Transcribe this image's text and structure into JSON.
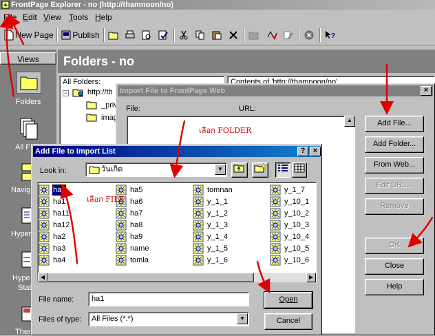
{
  "app": {
    "title": "FrontPage Explorer - no (http://thamnoon/no)",
    "menu": [
      "File",
      "Edit",
      "View",
      "Tools",
      "Help"
    ],
    "toolbar": {
      "new_page": "New Page",
      "publish": "Publish"
    }
  },
  "views": {
    "header": "Views",
    "items": [
      "Folders",
      "All F",
      "Navig",
      "Hyper",
      "Hype",
      "Stat",
      "Ther"
    ]
  },
  "folders_header": "Folders - no",
  "all_folders": {
    "label": "All Folders:",
    "root": "http://th",
    "children": [
      "_priv",
      "imag"
    ]
  },
  "contents_label": "Contents of 'http://thamnoon/no'",
  "import_dialog": {
    "title": "Import File to FrontPage Web",
    "col_file": "File:",
    "col_url": "URL:",
    "buttons": {
      "add_file": "Add File...",
      "add_folder": "Add Folder...",
      "from_web": "From Web...",
      "edit_url": "Edit URL...",
      "remove": "Remove",
      "ok": "OK",
      "close": "Close",
      "help": "Help"
    },
    "close_glyph": "×"
  },
  "add_dialog": {
    "title": "Add File to Import List",
    "help_glyph": "?",
    "close_glyph": "×",
    "look_in_label": "Look in:",
    "look_in_value": "วันเกิด",
    "files": [
      [
        "ha1",
        "ha1",
        "ha11",
        "ha12",
        "ha2",
        "ha3",
        "ha4"
      ],
      [
        "ha5",
        "ha6",
        "ha7",
        "ha8",
        "ha9",
        "name",
        "tomla"
      ],
      [
        "tomnan",
        "y_1_1",
        "y_1_2",
        "y_1_3",
        "y_1_4",
        "y_1_5",
        "y_1_6"
      ],
      [
        "y_1_7",
        "y_10_1",
        "y_10_2",
        "y_10_3",
        "y_10_4",
        "y_10_5",
        "y_10_6"
      ]
    ],
    "selected_file": "ha1",
    "file_name_label": "File name:",
    "file_name_value": "ha1",
    "files_of_type_label": "Files of type:",
    "files_of_type_value": "All Files (*.*)",
    "open_button": "Open",
    "cancel_button": "Cancel"
  },
  "annotations": {
    "choose_folder": "เลือก FOLDER",
    "choose_file": "เลือก FILE"
  },
  "colors": {
    "title_active": "#000080",
    "annotation": "#d00000",
    "desktop_gray": "#c0c0c0"
  }
}
